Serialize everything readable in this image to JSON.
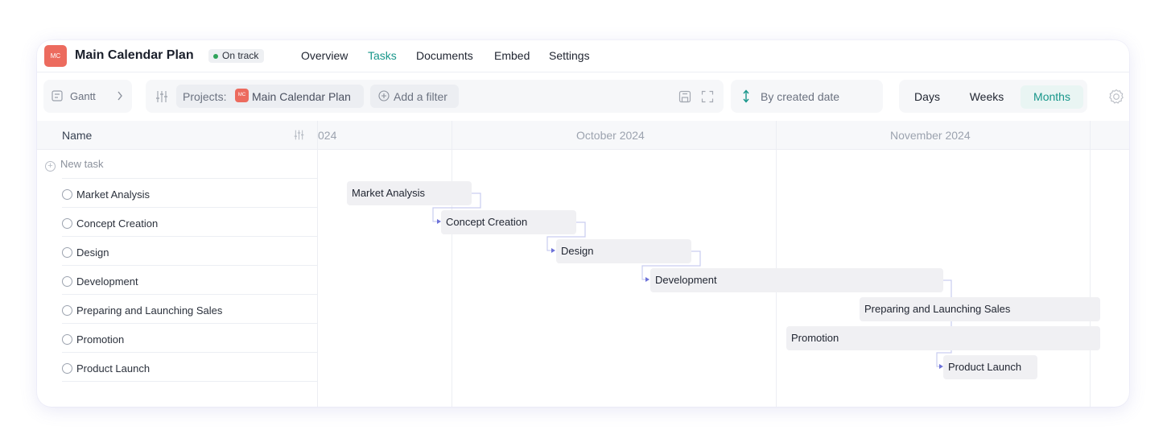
{
  "header": {
    "logo_text": "MC",
    "title": "Main Calendar Plan",
    "status": "On track",
    "nav": [
      "Overview",
      "Tasks",
      "Documents",
      "Embed",
      "Settings"
    ],
    "active_nav": "Tasks"
  },
  "toolbar": {
    "view_label": "Gantt",
    "projects_label": "Projects:",
    "project_logo_text": "MC",
    "project_name": "Main Calendar Plan",
    "add_filter": "Add a filter",
    "sort_label": "By created date",
    "scale": [
      "Days",
      "Weeks",
      "Months"
    ],
    "active_scale": "Months"
  },
  "grid": {
    "name_header": "Name",
    "new_task": "New task",
    "months": [
      "024",
      "October 2024",
      "November 2024"
    ],
    "tasks": [
      "Market Analysis",
      "Concept Creation",
      "Design",
      "Development",
      "Preparing and Launching Sales",
      "Promotion",
      "Product Launch"
    ]
  },
  "colors": {
    "accent": "#17968a",
    "brand": "#ec6b5e",
    "link": "#c9cdf0",
    "arrow": "#6d72d8"
  }
}
